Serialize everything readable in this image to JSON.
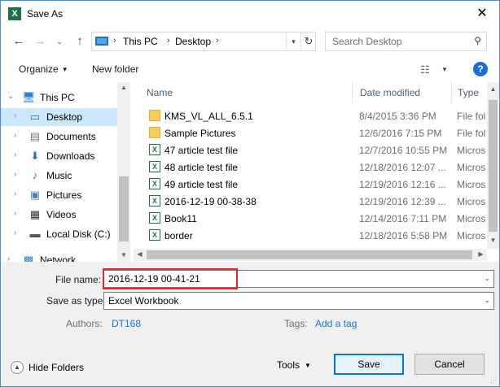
{
  "window": {
    "title": "Save As",
    "app_icon_glyph": "X",
    "close_glyph": "✕"
  },
  "navigation": {
    "back_glyph": "←",
    "forward_glyph": "→",
    "up_glyph": "↑",
    "recent_glyph": "⌄",
    "breadcrumb": [
      "This PC",
      "Desktop"
    ],
    "crumb_sep": "›",
    "search_placeholder": "Search Desktop"
  },
  "toolbar": {
    "organize_label": "Organize",
    "new_folder_label": "New folder",
    "help_label": "?"
  },
  "sidebar": {
    "items": [
      {
        "label": "This PC",
        "icon": "pc-icon",
        "glyph": "🖥",
        "level": 0
      },
      {
        "label": "Desktop",
        "icon": "desktop-icon",
        "glyph": "▭",
        "level": 1,
        "selected": true
      },
      {
        "label": "Documents",
        "icon": "documents-icon",
        "glyph": "▤",
        "level": 1
      },
      {
        "label": "Downloads",
        "icon": "downloads-icon",
        "glyph": "⬇",
        "level": 1
      },
      {
        "label": "Music",
        "icon": "music-icon",
        "glyph": "♪",
        "level": 1
      },
      {
        "label": "Pictures",
        "icon": "pictures-icon",
        "glyph": "▣",
        "level": 1
      },
      {
        "label": "Videos",
        "icon": "videos-icon",
        "glyph": "▦",
        "level": 1
      },
      {
        "label": "Local Disk (C:)",
        "icon": "disk-icon",
        "glyph": "▬",
        "level": 1
      },
      {
        "label": "Network",
        "icon": "network-icon",
        "glyph": "▩",
        "level": 0
      }
    ]
  },
  "file_list": {
    "columns": [
      "Name",
      "Date modified",
      "Type"
    ],
    "rows": [
      {
        "name": "KMS_VL_ALL_6.5.1",
        "date": "8/4/2015 3:36 PM",
        "type": "File fol",
        "kind": "folder"
      },
      {
        "name": "Sample Pictures",
        "date": "12/6/2016 7:15 PM",
        "type": "File fol",
        "kind": "folder"
      },
      {
        "name": "47 article test file",
        "date": "12/7/2016 10:55 PM",
        "type": "Micros",
        "kind": "excel"
      },
      {
        "name": "48 article test file",
        "date": "12/18/2016 12:07 ...",
        "type": "Micros",
        "kind": "excel"
      },
      {
        "name": "49 article test file",
        "date": "12/19/2016 12:16 ...",
        "type": "Micros",
        "kind": "excel"
      },
      {
        "name": "2016-12-19 00-38-38",
        "date": "12/19/2016 12:39 ...",
        "type": "Micros",
        "kind": "excel"
      },
      {
        "name": "Book11",
        "date": "12/14/2016 7:11 PM",
        "type": "Micros",
        "kind": "excel"
      },
      {
        "name": "border",
        "date": "12/18/2016 5:58 PM",
        "type": "Micros",
        "kind": "excel"
      }
    ]
  },
  "form": {
    "file_name_label": "File name:",
    "file_name_value": "2016-12-19 00-41-21",
    "save_as_type_label": "Save as type:",
    "save_as_type_value": "Excel Workbook",
    "authors_label": "Authors:",
    "authors_value": "DT168",
    "tags_label": "Tags:",
    "tags_value": "Add a tag"
  },
  "footer": {
    "hide_folders_label": "Hide Folders",
    "tools_label": "Tools",
    "save_label": "Save",
    "cancel_label": "Cancel"
  }
}
